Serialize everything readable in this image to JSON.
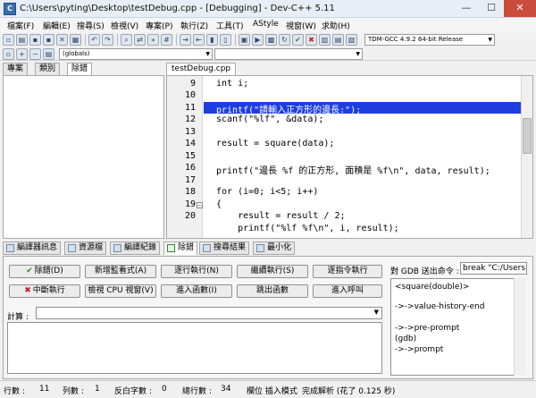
{
  "window": {
    "title": "C:\\Users\\pyting\\Desktop\\testDebug.cpp - [Debugging] - Dev-C++ 5.11",
    "min": "—",
    "max": "☐",
    "close": "✕"
  },
  "menu": [
    "檔案(F)",
    "編輯(E)",
    "搜尋(S)",
    "檢視(V)",
    "專案(P)",
    "執行(Z)",
    "工具(T)",
    "AStyle",
    "視窗(W)",
    "求助(H)"
  ],
  "toolbar": {
    "compiler": "TDM-GCC 4.9.2 64-bit Release",
    "scope": "(globals)"
  },
  "left_tabs": [
    "專案",
    "類別",
    "除錯"
  ],
  "editor": {
    "file_tab": "testDebug.cpp",
    "lines": [
      {
        "n": "9",
        "code": "int i;"
      },
      {
        "n": "10",
        "code": ""
      },
      {
        "n": "11",
        "code": "printf(\"請輸入正方形的邊長:\");"
      },
      {
        "n": "12",
        "code": "scanf(\"%lf\", &data);"
      },
      {
        "n": "13",
        "code": ""
      },
      {
        "n": "14",
        "code": "result = square(data);"
      },
      {
        "n": "15",
        "code": ""
      },
      {
        "n": "16",
        "code": "printf(\"邊長 %f 的正方形, 面積是 %f\\n\", data, result);"
      },
      {
        "n": "17",
        "code": ""
      },
      {
        "n": "18",
        "code": "for (i=0; i<5; i++)"
      },
      {
        "n": "19",
        "code": "{"
      },
      {
        "n": "20",
        "code": "    result = result / 2;"
      }
    ],
    "partial_line": "    printf(\"%lf %f\\n\", i, result);"
  },
  "bottom_tabs": [
    "編譯器訊息",
    "資源檔",
    "編譯紀錄",
    "除錯",
    "搜尋結果",
    "最小化"
  ],
  "debug": {
    "buttons": [
      "除錯(D)",
      "新增監看式(A)",
      "逐行執行(N)",
      "繼續執行(S)",
      "逐指令執行",
      "中斷執行",
      "檢視 CPU 視窗(V)",
      "進入函數(I)",
      "跳出函數",
      "進入呼叫"
    ],
    "calc_label": "計算 :",
    "gdb_label": "對 GDB 送出命令 :",
    "gdb_value": "break \"C:/Users",
    "gdb_output": [
      "<square(double)>",
      "",
      "->->value-history-end",
      "",
      "->->pre-prompt",
      "(gdb)",
      "->->prompt"
    ]
  },
  "status": {
    "row_label": "行數 :",
    "row": "11",
    "col_label": "列數 :",
    "col": "1",
    "sel_label": "反白字數 :",
    "sel": "0",
    "total_label": "總行數 :",
    "total": "34",
    "mode": "欄位 插入模式",
    "parse": "完成解析 (花了 0.125 秒)"
  }
}
